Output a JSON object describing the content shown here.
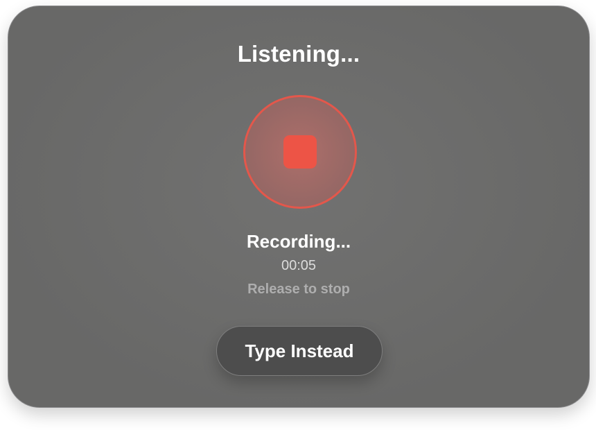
{
  "title": "Listening...",
  "record_button": {
    "icon": "stop-icon",
    "ring_color": "#e4574b",
    "icon_color": "#ed5446"
  },
  "status": {
    "label": "Recording...",
    "elapsed": "00:05",
    "hint": "Release to stop"
  },
  "actions": {
    "type_instead_label": "Type Instead"
  }
}
